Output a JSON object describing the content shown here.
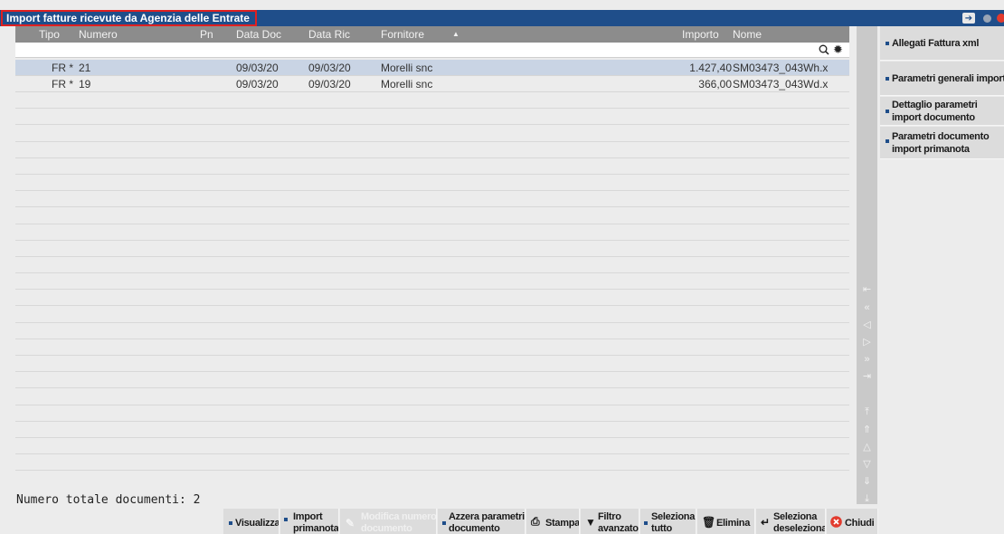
{
  "window": {
    "title": "Import fatture ricevute da Agenzia delle Entrate"
  },
  "columns": {
    "tipo": "Tipo",
    "numero": "Numero",
    "pn": "Pn",
    "data_doc": "Data Doc",
    "data_ric": "Data Ric",
    "fornitore": "Fornitore",
    "importo": "Importo",
    "nome": "Nome"
  },
  "rows": [
    {
      "tipo": "FR *",
      "numero": "21",
      "pn": "",
      "data_doc": "09/03/20",
      "data_ric": "09/03/20",
      "fornitore": "Morelli snc",
      "importo": "1.427,40",
      "nome": "SM03473_043Wh.x"
    },
    {
      "tipo": "FR *",
      "numero": "19",
      "pn": "",
      "data_doc": "09/03/20",
      "data_ric": "09/03/20",
      "fornitore": "Morelli snc",
      "importo": "366,00",
      "nome": "SM03473_043Wd.x"
    }
  ],
  "sidebar": {
    "allegati": "Allegati Fattura xml",
    "parametri_generali": "Parametri generali import",
    "dettaglio_1": "Dettaglio parametri",
    "dettaglio_2": "import documento",
    "param_doc_1": "Parametri documento",
    "param_doc_2": "import primanota"
  },
  "footer": {
    "total": "Numero totale documenti: 2"
  },
  "toolbar": {
    "visualizza": "Visualizza",
    "import_1": "Import",
    "import_2": "primanota",
    "modifica_1": "Modifica numero",
    "modifica_2": "documento",
    "azzera_1": "Azzera parametri",
    "azzera_2": "documento",
    "stampa": "Stampa",
    "filtro_1": "Filtro",
    "filtro_2": "avanzato",
    "seleziona_1": "Seleziona",
    "seleziona_2": "tutto",
    "elimina": "Elimina",
    "seldesel_1": "Seleziona",
    "seldesel_2": "deseleziona",
    "chiudi": "Chiudi"
  },
  "colors": {
    "titlebar": "#1f4e8a",
    "title_border": "#e02020",
    "header": "#8c8c8c",
    "selected_row": "#c9d4e4",
    "close": "#e23b2e"
  },
  "icons": [
    "pin-icon",
    "minimize-dot-icon",
    "close-icon",
    "search-icon",
    "gear-icon",
    "printer-icon",
    "filter-icon",
    "trash-icon",
    "return-icon",
    "close-circle-icon",
    "pencil-icon"
  ]
}
